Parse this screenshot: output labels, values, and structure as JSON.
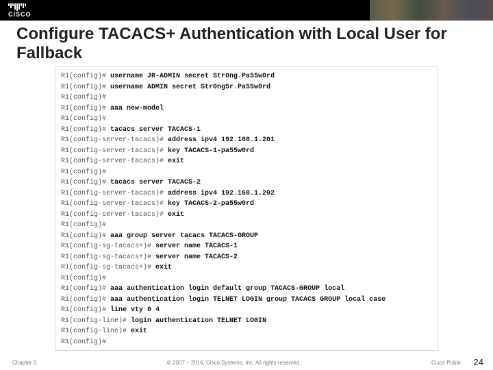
{
  "header": {
    "logo_text": "CISCO"
  },
  "title": "Configure TACACS+ Authentication with Local User for Fallback",
  "terminal": {
    "lines": [
      {
        "prompt": "R1(config)# ",
        "cmd": "username JR-ADMIN secret Str0ng.Pa55w0rd"
      },
      {
        "prompt": "R1(config)# ",
        "cmd": "username ADMIN secret Str0ng5r.Pa55w0rd"
      },
      {
        "prompt": "R1(config)#",
        "cmd": ""
      },
      {
        "prompt": "R1(config)# ",
        "cmd": "aaa new-model"
      },
      {
        "prompt": "R1(config)#",
        "cmd": ""
      },
      {
        "prompt": "R1(config)# ",
        "cmd": "tacacs server TACACS-1"
      },
      {
        "prompt": "R1(config-server-tacacs)# ",
        "cmd": "address ipv4 192.168.1.201"
      },
      {
        "prompt": "R1(config-server-tacacs)# ",
        "cmd": "key TACACS-1-pa55w0rd"
      },
      {
        "prompt": "R1(config-server-tacacs)# ",
        "cmd": "exit"
      },
      {
        "prompt": "R1(config)#",
        "cmd": ""
      },
      {
        "prompt": "R1(config)# ",
        "cmd": "tacacs server TACACS-2"
      },
      {
        "prompt": "R1(config-server-tacacs)# ",
        "cmd": "address ipv4 192.168.1.202"
      },
      {
        "prompt": "R1(config-server-tacacs)# ",
        "cmd": "key TACACS-2-pa55w0rd"
      },
      {
        "prompt": "R1(config-server-tacacs)# ",
        "cmd": "exit"
      },
      {
        "prompt": "R1(config)#",
        "cmd": ""
      },
      {
        "prompt": "R1(config)# ",
        "cmd": "aaa group server tacacs TACACS-GROUP"
      },
      {
        "prompt": "R1(config-sg-tacacs+)# ",
        "cmd": "server name TACACS-1"
      },
      {
        "prompt": "R1(config-sg-tacacs+)# ",
        "cmd": "server name TACACS-2"
      },
      {
        "prompt": "R1(config-sg-tacacs+)# ",
        "cmd": "exit"
      },
      {
        "prompt": "R1(config)#",
        "cmd": ""
      },
      {
        "prompt": "R1(config)# ",
        "cmd": "aaa authentication login default group TACACS-GROUP local"
      },
      {
        "prompt": "R1(config)# ",
        "cmd": "aaa authentication login TELNET LOGIN group TACACS GROUP local case"
      },
      {
        "prompt": "R1(config)# ",
        "cmd": "line vty 0 4"
      },
      {
        "prompt": "R1(config-line)# ",
        "cmd": "login authentication TELNET LOGIN"
      },
      {
        "prompt": "R1(config-line)# ",
        "cmd": "exit"
      },
      {
        "prompt": "R1(config)#",
        "cmd": ""
      }
    ]
  },
  "footer": {
    "chapter": "Chapter 3",
    "copyright": "© 2007 – 2016, Cisco Systems, Inc. All rights reserved.",
    "public": "Cisco Public",
    "page": "24"
  }
}
